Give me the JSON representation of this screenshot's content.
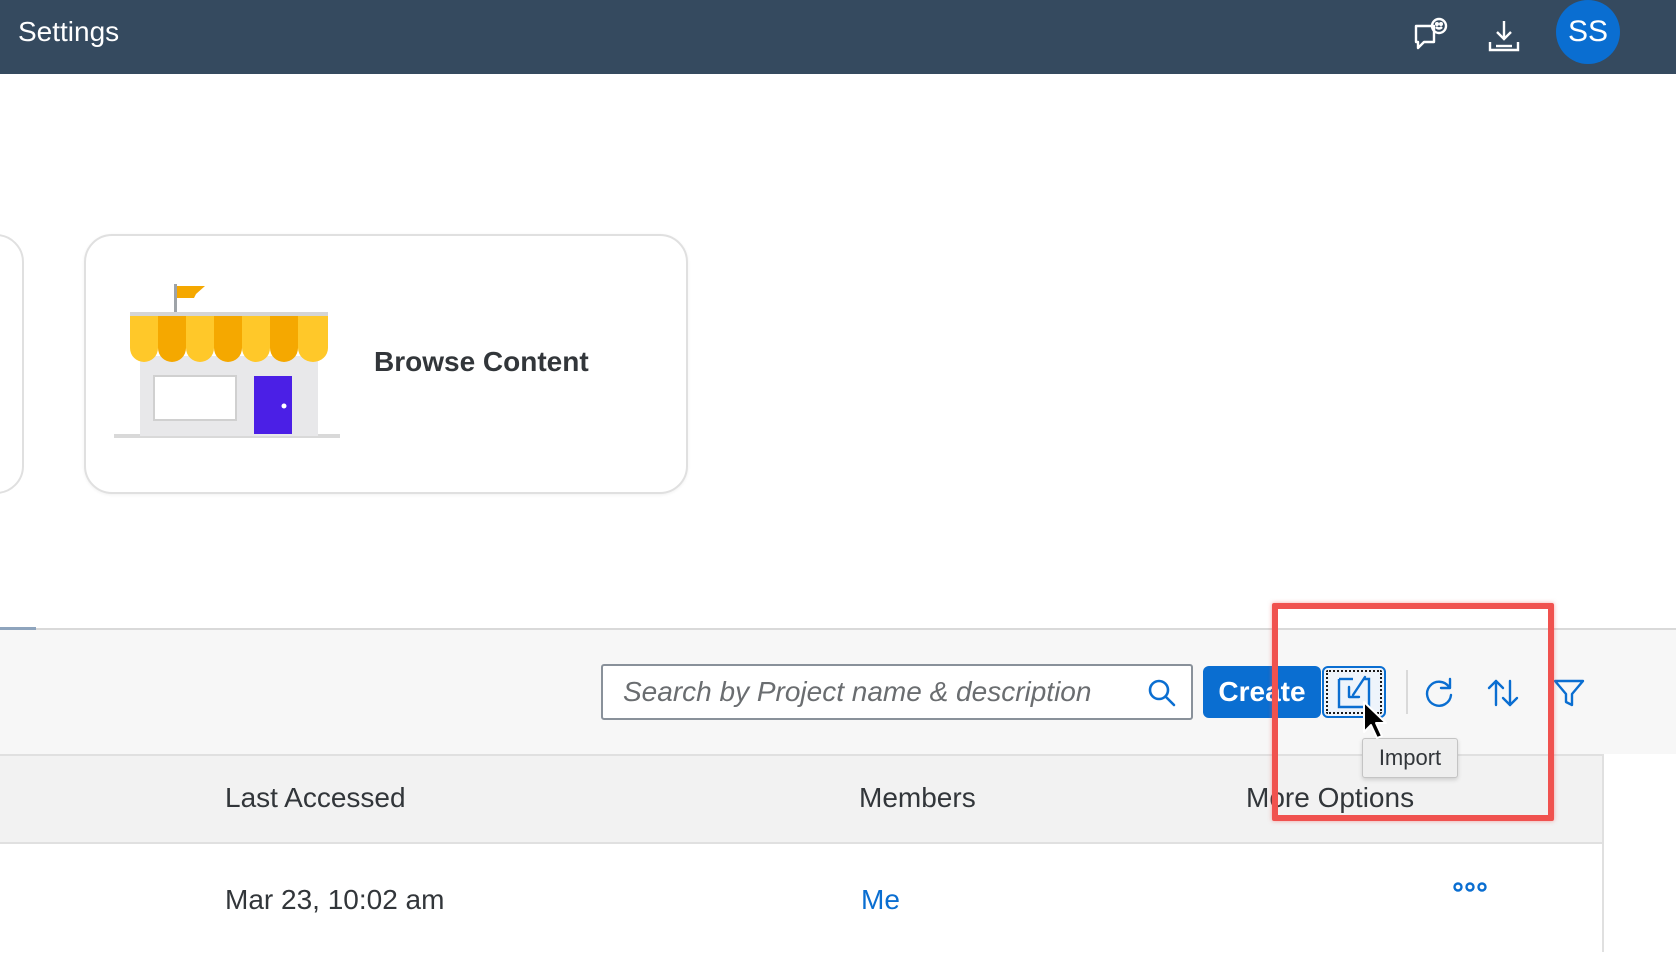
{
  "shell": {
    "title": "Settings",
    "avatar_initials": "SS",
    "icons": [
      "feedback-icon",
      "download-icon"
    ]
  },
  "tiles": [
    {
      "label": "Browse Content",
      "icon": "storefront-illustration"
    }
  ],
  "toolbar": {
    "search_placeholder": "Search by Project name & description",
    "create_label": "Create",
    "import_tooltip": "Import",
    "icons": [
      "search-icon",
      "import-icon",
      "refresh-icon",
      "sort-icon",
      "filter-icon"
    ]
  },
  "table": {
    "columns": [
      "Last Accessed",
      "Members",
      "More Options"
    ],
    "rows": [
      {
        "last_accessed": "Mar 23, 10:02 am",
        "members": "Me"
      }
    ]
  },
  "colors": {
    "shell_bg": "#354a5f",
    "accent": "#0a6ed1",
    "highlight": "#f0524f"
  }
}
